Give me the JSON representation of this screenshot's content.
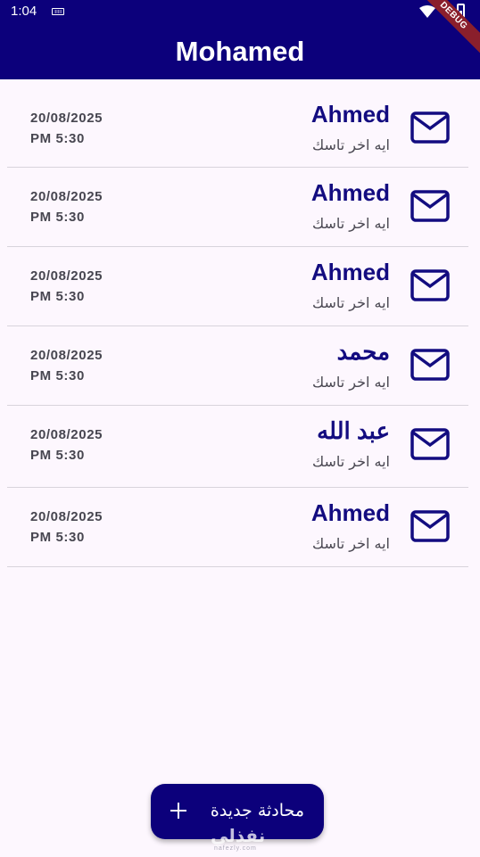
{
  "status_bar": {
    "time": "1:04",
    "debug": "DEBUG"
  },
  "app_bar": {
    "title": "Mohamed"
  },
  "conversations": [
    {
      "name": "Ahmed",
      "message": "ايه اخر تاسك",
      "date": "20/08/2025",
      "time": "PM 5:30"
    },
    {
      "name": "Ahmed",
      "message": "ايه اخر تاسك",
      "date": "20/08/2025",
      "time": "PM 5:30"
    },
    {
      "name": "Ahmed",
      "message": "ايه اخر تاسك",
      "date": "20/08/2025",
      "time": "PM 5:30"
    },
    {
      "name": "محمد",
      "message": "ايه اخر تاسك",
      "date": "20/08/2025",
      "time": "PM 5:30"
    },
    {
      "name": "عبد الله",
      "message": "ايه اخر تاسك",
      "date": "20/08/2025",
      "time": "PM 5:30"
    },
    {
      "name": "Ahmed",
      "message": "ايه اخر تاسك",
      "date": "20/08/2025",
      "time": "PM 5:30"
    }
  ],
  "fab": {
    "label": "محادثة جديدة",
    "icon": "plus-icon"
  },
  "watermark": {
    "text": "نفذلي",
    "sub": "nafezly.com"
  },
  "colors": {
    "primary": "#0C007B",
    "background": "#FDF7FE",
    "name_text": "#130C80",
    "divider": "#D8D4DC"
  }
}
